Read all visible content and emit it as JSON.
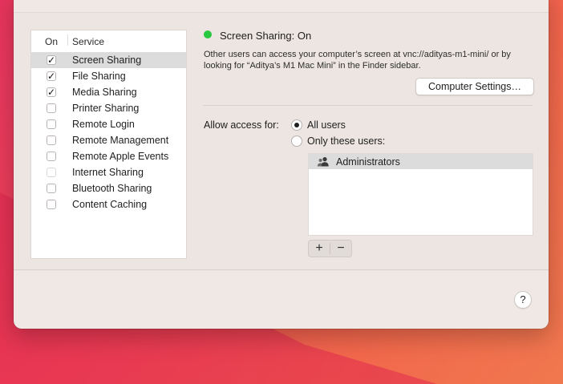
{
  "services": {
    "header_on": "On",
    "header_service": "Service",
    "items": [
      {
        "label": "Screen Sharing",
        "mark": "✓",
        "selected": true
      },
      {
        "label": "File Sharing",
        "mark": "✓",
        "selected": false
      },
      {
        "label": "Media Sharing",
        "mark": "✓",
        "selected": false
      },
      {
        "label": "Printer Sharing",
        "mark": "",
        "selected": false
      },
      {
        "label": "Remote Login",
        "mark": "",
        "selected": false
      },
      {
        "label": "Remote Management",
        "mark": "",
        "selected": false
      },
      {
        "label": "Remote Apple Events",
        "mark": "",
        "selected": false
      },
      {
        "label": "Internet Sharing",
        "mark": "",
        "selected": false,
        "disabled": true
      },
      {
        "label": "Bluetooth Sharing",
        "mark": "",
        "selected": false
      },
      {
        "label": "Content Caching",
        "mark": "",
        "selected": false
      }
    ]
  },
  "detail": {
    "status_color": "#2ac840",
    "status_text": "Screen Sharing: On",
    "description": "Other users can access your computer’s screen at vnc://adityas-m1-mini/ or by looking for “Aditya’s M1 Mac Mini” in the Finder sidebar.",
    "computer_settings_label": "Computer Settings…",
    "allow_access_label": "Allow access for:",
    "radio_all_users": "All users",
    "radio_only_these": "Only these users:",
    "users": [
      "Administrators"
    ],
    "add_symbol": "+",
    "remove_symbol": "−"
  },
  "footer": {
    "help_symbol": "?"
  }
}
